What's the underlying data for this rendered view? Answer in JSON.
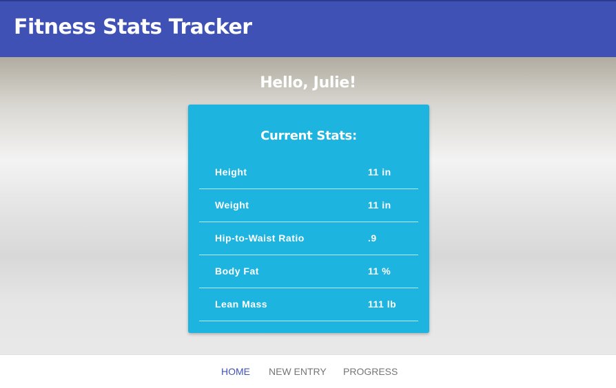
{
  "header": {
    "title": "Fitness Stats Tracker"
  },
  "main": {
    "greeting": "Hello, Julie!",
    "card": {
      "title": "Current Stats:",
      "rows": [
        {
          "label": "Height",
          "value": "11 in"
        },
        {
          "label": "Weight",
          "value": "11 in"
        },
        {
          "label": "Hip-to-Waist Ratio",
          "value": ".9"
        },
        {
          "label": "Body Fat",
          "value": "11 %"
        },
        {
          "label": "Lean Mass",
          "value": "111 lb"
        }
      ]
    }
  },
  "nav": {
    "items": [
      {
        "label": "HOME",
        "active": true
      },
      {
        "label": "NEW ENTRY",
        "active": false
      },
      {
        "label": "PROGRESS",
        "active": false
      }
    ]
  },
  "colors": {
    "header_bg": "#3f51b5",
    "card_bg": "#1eb4e0",
    "nav_active": "#3f51b5",
    "nav_inactive": "#757575"
  }
}
